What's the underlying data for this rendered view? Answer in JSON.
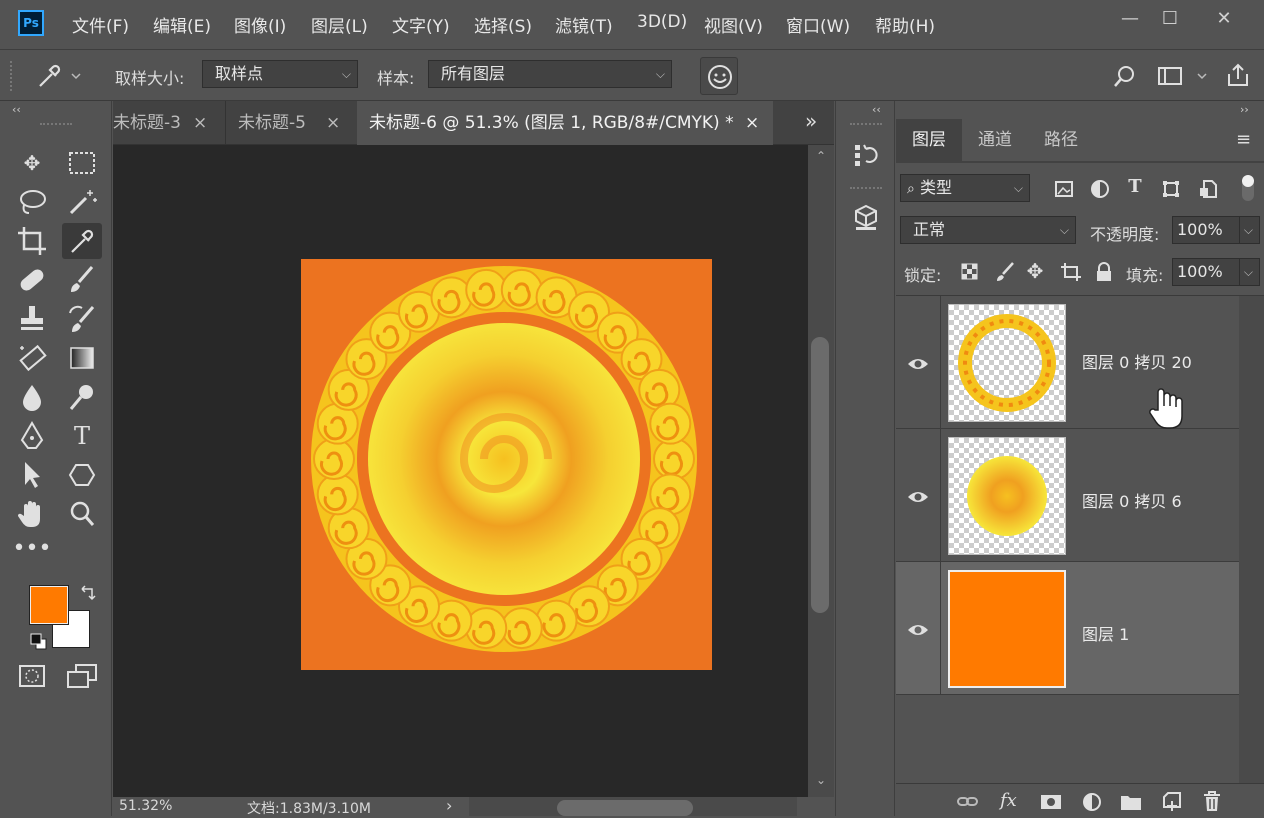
{
  "app": {
    "logo": "Ps"
  },
  "menu": [
    "文件(F)",
    "编辑(E)",
    "图像(I)",
    "图层(L)",
    "文字(Y)",
    "选择(S)",
    "滤镜(T)",
    "3D(D)",
    "视图(V)",
    "窗口(W)",
    "帮助(H)"
  ],
  "window_controls": {
    "minimize": "—",
    "maximize": "☐",
    "close": "✕"
  },
  "options": {
    "sample_size_label": "取样大小:",
    "sample_size_value": "取样点",
    "sample_label": "样本:",
    "sample_value": "所有图层"
  },
  "tabs": [
    {
      "label": "未标题-3",
      "close": "×"
    },
    {
      "label": "未标题-5",
      "close": "×"
    },
    {
      "label": "未标题-6 @ 51.3% (图层 1, RGB/8#/CMYK) *",
      "close": "×"
    }
  ],
  "tabs_overflow": "»",
  "status": {
    "zoom": "51.32%",
    "doc": "文档:1.83M/3.10M",
    "arrow": "›"
  },
  "colors": {
    "foreground": "#ff7a00",
    "background": "#ffffff",
    "canvas_bg": "#ec7320"
  },
  "panel": {
    "tabs": [
      "图层",
      "通道",
      "路径"
    ],
    "filter_label": "类型",
    "blend_mode": "正常",
    "opacity_label": "不透明度:",
    "opacity_value": "100%",
    "lock_label": "锁定:",
    "fill_label": "填充:",
    "fill_value": "100%"
  },
  "layers": [
    {
      "name": "图层 0 拷贝 20",
      "thumb": "ring"
    },
    {
      "name": "图层 0 拷贝 6",
      "thumb": "sun"
    },
    {
      "name": "图层 1",
      "thumb": "solid",
      "selected": true
    }
  ],
  "bottom_icons": [
    "link-icon",
    "fx-icon",
    "mask-icon",
    "adjustment-icon",
    "folder-icon",
    "new-layer-icon",
    "trash-icon"
  ]
}
